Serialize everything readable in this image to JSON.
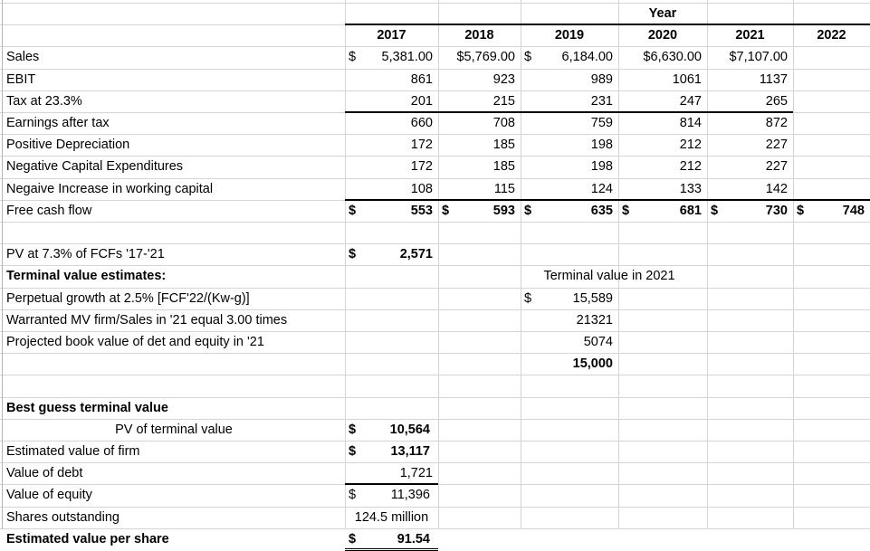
{
  "sheet": {
    "header": {
      "group_label": "Year",
      "years": [
        "2017",
        "2018",
        "2019",
        "2020",
        "2021",
        "2022"
      ]
    },
    "rows": [
      {
        "label": "Sales",
        "values": [
          {
            "cur": "$",
            "num": "5,381.00"
          },
          {
            "cur": "",
            "num": "$5,769.00"
          },
          {
            "cur": "$",
            "num": "6,184.00"
          },
          {
            "cur": "",
            "num": "$6,630.00"
          },
          {
            "cur": "",
            "num": "$7,107.00"
          },
          {
            "cur": "",
            "num": ""
          }
        ]
      },
      {
        "label": "EBIT",
        "values": [
          {
            "cur": "",
            "num": "861"
          },
          {
            "cur": "",
            "num": "923"
          },
          {
            "cur": "",
            "num": "989"
          },
          {
            "cur": "",
            "num": "1061"
          },
          {
            "cur": "",
            "num": "1137"
          },
          {
            "cur": "",
            "num": ""
          }
        ]
      },
      {
        "label": "Tax at 23.3%",
        "values": [
          {
            "cur": "",
            "num": "201"
          },
          {
            "cur": "",
            "num": "215"
          },
          {
            "cur": "",
            "num": "231"
          },
          {
            "cur": "",
            "num": "247"
          },
          {
            "cur": "",
            "num": "265"
          },
          {
            "cur": "",
            "num": ""
          }
        ]
      },
      {
        "label": "Earnings after tax",
        "values": [
          {
            "cur": "",
            "num": "660"
          },
          {
            "cur": "",
            "num": "708"
          },
          {
            "cur": "",
            "num": "759"
          },
          {
            "cur": "",
            "num": "814"
          },
          {
            "cur": "",
            "num": "872"
          },
          {
            "cur": "",
            "num": ""
          }
        ]
      },
      {
        "label": "Positive Depreciation",
        "values": [
          {
            "cur": "",
            "num": "172"
          },
          {
            "cur": "",
            "num": "185"
          },
          {
            "cur": "",
            "num": "198"
          },
          {
            "cur": "",
            "num": "212"
          },
          {
            "cur": "",
            "num": "227"
          },
          {
            "cur": "",
            "num": ""
          }
        ]
      },
      {
        "label": "Negative Capital Expenditures",
        "values": [
          {
            "cur": "",
            "num": "172"
          },
          {
            "cur": "",
            "num": "185"
          },
          {
            "cur": "",
            "num": "198"
          },
          {
            "cur": "",
            "num": "212"
          },
          {
            "cur": "",
            "num": "227"
          },
          {
            "cur": "",
            "num": ""
          }
        ]
      },
      {
        "label": "Negaive Increase in working capital",
        "values": [
          {
            "cur": "",
            "num": "108"
          },
          {
            "cur": "",
            "num": "115"
          },
          {
            "cur": "",
            "num": "124"
          },
          {
            "cur": "",
            "num": "133"
          },
          {
            "cur": "",
            "num": "142"
          },
          {
            "cur": "",
            "num": ""
          }
        ]
      },
      {
        "label": "Free cash flow",
        "bold_values": true,
        "values": [
          {
            "cur": "$",
            "num": "553"
          },
          {
            "cur": "$",
            "num": "593"
          },
          {
            "cur": "$",
            "num": "635"
          },
          {
            "cur": "$",
            "num": "681"
          },
          {
            "cur": "$",
            "num": "730"
          },
          {
            "cur": "$",
            "num": "748"
          }
        ]
      }
    ],
    "pv_fcf": {
      "label": "PV at 7.3% of FCFs '17-'21",
      "cur": "$",
      "value": "2,571"
    },
    "terminal": {
      "heading": "Terminal value estimates:",
      "column_title": "Terminal value in 2021",
      "estimates": [
        {
          "label": "Perpetual growth at 2.5% [FCF'22/(Kw-g)]",
          "cur": "$",
          "value": "15,589"
        },
        {
          "label": "Warranted MV firm/Sales in '21 equal 3.00 times",
          "cur": "",
          "value": "21321"
        },
        {
          "label": "Projected book value of det and equity in '21",
          "cur": "",
          "value": "5074"
        }
      ],
      "best_guess_value": "15,000"
    },
    "summary": {
      "heading": "Best guess terminal value",
      "items": [
        {
          "label": "PV of terminal value",
          "cur": "$",
          "value": "10,564",
          "bold_value": true,
          "indent": true
        },
        {
          "label": "Estimated value of firm",
          "cur": "$",
          "value": "13,117",
          "bold_value": true
        },
        {
          "label": "Value of debt",
          "cur": "",
          "value": "1,721"
        },
        {
          "label": "Value of equity",
          "cur": "$",
          "value": "11,396"
        },
        {
          "label": "Shares outstanding",
          "cur": "",
          "value": "124.5 million"
        },
        {
          "label": "Estimated value per share",
          "cur": "$",
          "value": "91.54",
          "bold": true
        }
      ]
    }
  }
}
